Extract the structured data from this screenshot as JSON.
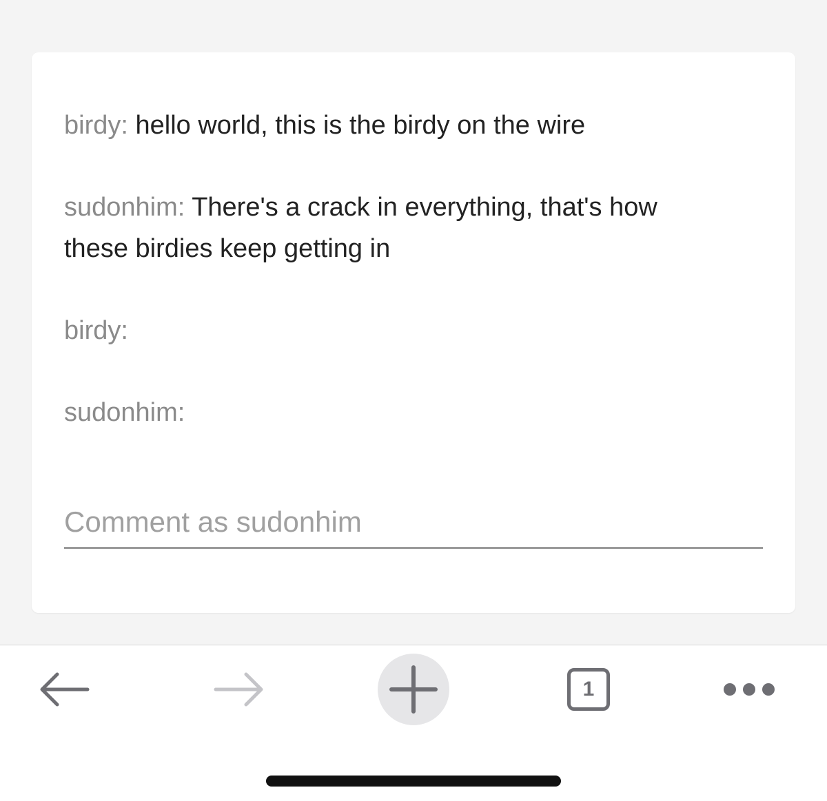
{
  "comments": [
    {
      "author": "birdy:",
      "text": "hello world, this is the birdy on the wire"
    },
    {
      "author": "sudonhim:",
      "text": "There's a crack in everything, that's how these birdies keep getting in"
    },
    {
      "author": "birdy:",
      "text": ""
    },
    {
      "author": "sudonhim:",
      "text": ""
    }
  ],
  "comment_input": {
    "placeholder": "Comment as sudonhim",
    "value": ""
  },
  "toolbar": {
    "tab_count": "1",
    "icons": [
      "back-arrow-icon",
      "forward-arrow-icon",
      "plus-icon",
      "tabs-icon",
      "more-dots-icon"
    ],
    "colors": {
      "icon_active": "#6e6e73",
      "icon_disabled": "#c4c4c8",
      "new_tab_bg": "#e6e6e8"
    }
  }
}
